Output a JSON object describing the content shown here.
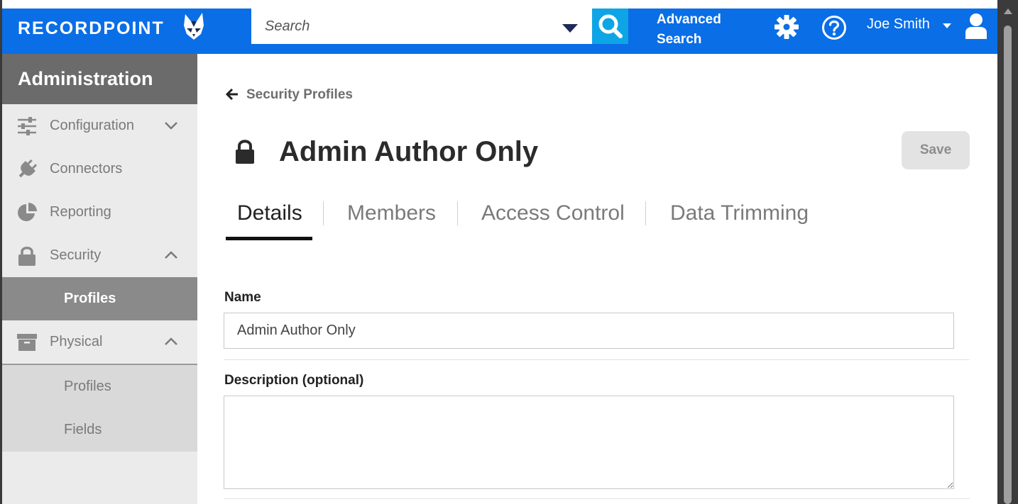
{
  "header": {
    "logo_text": "RECORDPOINT",
    "search_placeholder": "Search",
    "advanced_search_label": "Advanced Search",
    "user_name": "Joe Smith",
    "brand_color": "#0a6ee6",
    "search_button_color": "#0ea5e6"
  },
  "sidebar": {
    "title": "Administration",
    "items": [
      {
        "label": "Configuration",
        "icon": "sliders-icon",
        "chevron": "down"
      },
      {
        "label": "Connectors",
        "icon": "plug-icon"
      },
      {
        "label": "Reporting",
        "icon": "pie-chart-icon"
      },
      {
        "label": "Security",
        "icon": "lock-icon",
        "chevron": "up"
      },
      {
        "label": "Physical",
        "icon": "archive-box-icon",
        "chevron": "up"
      }
    ],
    "security_sub": [
      {
        "label": "Profiles",
        "active": true
      }
    ],
    "physical_sub": [
      {
        "label": "Profiles"
      },
      {
        "label": "Fields"
      }
    ]
  },
  "main": {
    "breadcrumb": "Security Profiles",
    "title": "Admin Author Only",
    "save_label": "Save",
    "tabs": [
      {
        "label": "Details",
        "active": true
      },
      {
        "label": "Members"
      },
      {
        "label": "Access Control"
      },
      {
        "label": "Data Trimming"
      }
    ],
    "form": {
      "name_label": "Name",
      "name_value": "Admin Author Only",
      "description_label": "Description (optional)",
      "description_value": ""
    }
  }
}
